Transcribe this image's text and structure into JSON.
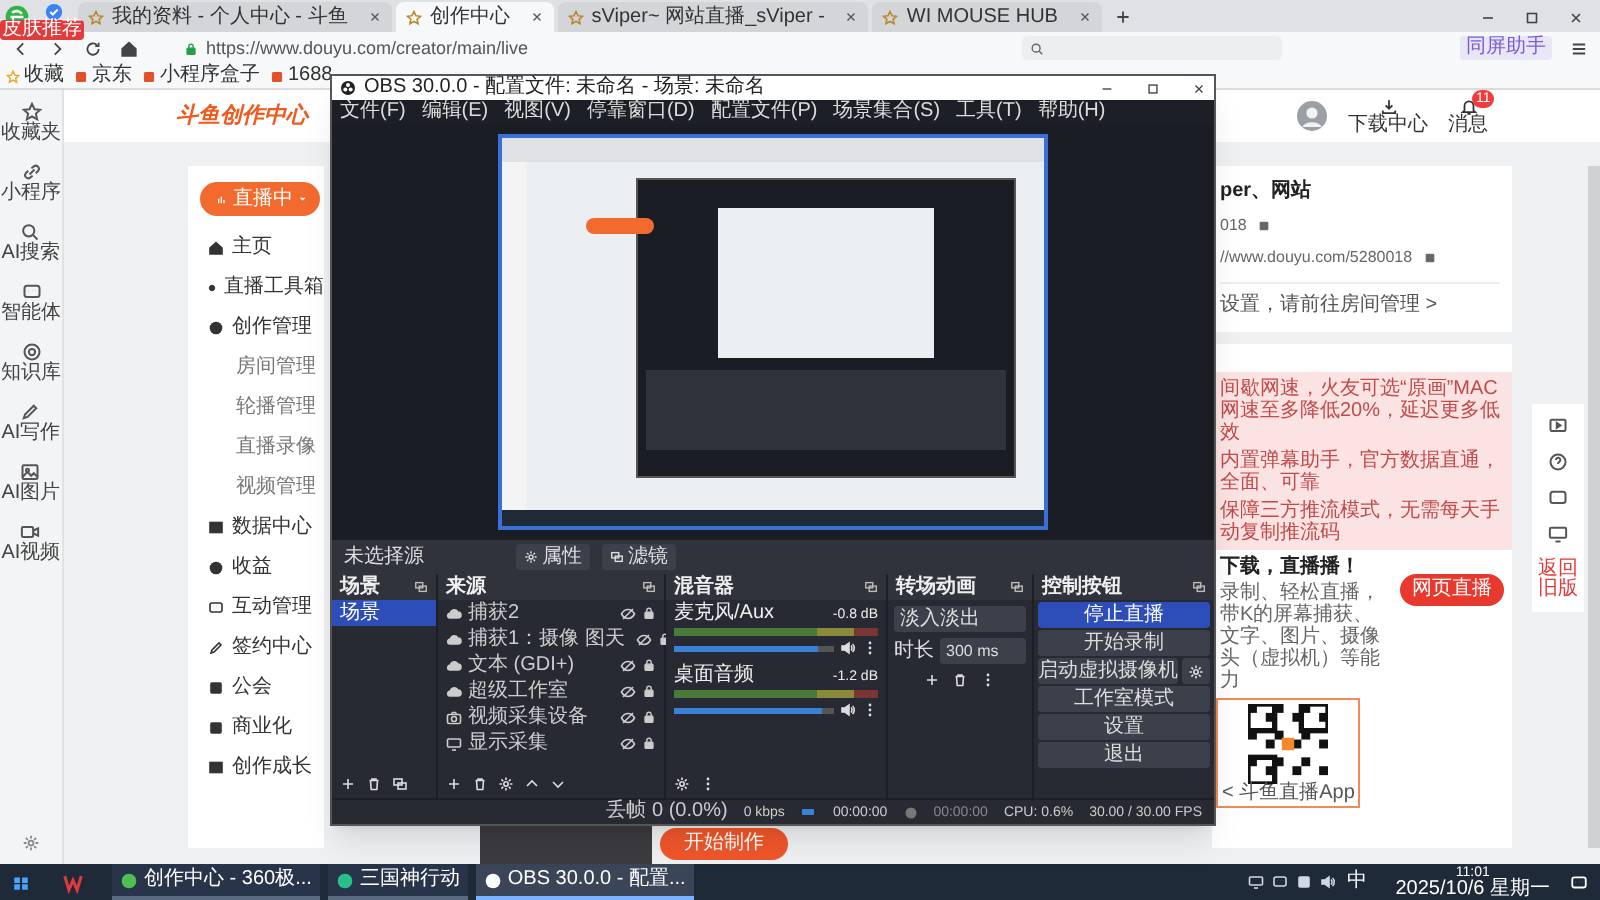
{
  "browser": {
    "tabs": [
      {
        "title": "我的资料 - 个人中心 - 斗鱼",
        "selected": false
      },
      {
        "title": "创作中心",
        "selected": true
      },
      {
        "title": "sViper~ 网站直播_sViper -",
        "selected": false
      },
      {
        "title": "WI MOUSE HUB",
        "selected": false
      }
    ],
    "skin_label": "皮肤推荐",
    "address": "https://www.douyu.com/creator/main/live",
    "bookmarks": [
      "收藏",
      "京东",
      "小程序盒子",
      "1688"
    ],
    "sync_button": "同屏助手"
  },
  "rail": [
    "收藏夹",
    "小程序",
    "AI搜索",
    "智能体",
    "知识库",
    "AI写作",
    "AI图片",
    "AI视频"
  ],
  "header": {
    "logo": "斗鱼创作中心",
    "download": "下载中心",
    "messages": "消息",
    "badge": "11"
  },
  "nav": {
    "live_button": "直播中",
    "items": [
      {
        "label": "主页",
        "kind": "main"
      },
      {
        "label": "直播工具箱",
        "kind": "main"
      },
      {
        "label": "创作管理",
        "kind": "main"
      },
      {
        "label": "房间管理",
        "kind": "sub"
      },
      {
        "label": "轮播管理",
        "kind": "sub"
      },
      {
        "label": "直播录像",
        "kind": "sub"
      },
      {
        "label": "视频管理",
        "kind": "sub"
      },
      {
        "label": "数据中心",
        "kind": "main"
      },
      {
        "label": "收益",
        "kind": "main"
      },
      {
        "label": "互动管理",
        "kind": "main"
      },
      {
        "label": "签约中心",
        "kind": "main"
      },
      {
        "label": "公会",
        "kind": "main"
      },
      {
        "label": "商业化",
        "kind": "main"
      },
      {
        "label": "创作成长",
        "kind": "main"
      }
    ]
  },
  "profile": {
    "name": "per、网站",
    "room": "018",
    "link": "//www.douyu.com/5280018",
    "hint": "设置，请前往房间管理 >"
  },
  "features": [
    "间歇网速，火友可选“原画”MAC网速至多降低20%，延迟更多低效",
    "内置弹幕助手，官方数据直通，全面、可靠",
    "保障三方推流模式，无需每天手动复制推流码"
  ],
  "promo": {
    "title": "下载，直播播！",
    "text": "录制、轻松直播，带K的屏幕捕获、文字、图片、摄像头（虚拟机）等能力",
    "button": "网页直播",
    "qr_caption": "< 斗鱼直播App"
  },
  "start_button": "开始制作",
  "float_bar": {
    "old_version": "返回旧版"
  },
  "obs": {
    "title": "OBS 30.0.0 - 配置文件: 未命名 - 场景: 未命名",
    "menu": [
      "文件(F)",
      "编辑(E)",
      "视图(V)",
      "停靠窗口(D)",
      "配置文件(P)",
      "场景集合(S)",
      "工具(T)",
      "帮助(H)"
    ],
    "no_source": "未选择源",
    "properties": "属性",
    "filters": "滤镜",
    "scenes": {
      "title": "场景",
      "items": [
        {
          "label": "场景",
          "selected": true
        }
      ]
    },
    "sources": {
      "title": "来源",
      "items": [
        {
          "label": "捕获2",
          "kind": "capture"
        },
        {
          "label": "捕获1：摄像 图天",
          "kind": "capture"
        },
        {
          "label": "文本 (GDI+)",
          "kind": "capture"
        },
        {
          "label": "超级工作室",
          "kind": "capture"
        },
        {
          "label": "视频采集设备",
          "kind": "camera"
        },
        {
          "label": "显示采集",
          "kind": "display"
        }
      ]
    },
    "mixer": {
      "title": "混音器",
      "channels": [
        {
          "name": "麦克风/Aux",
          "reading": "-0.8 dB",
          "level": 0.9
        },
        {
          "name": "桌面音频",
          "reading": "-1.2 dB",
          "level": 0.92
        }
      ]
    },
    "transitions": {
      "title": "转场动画",
      "type": "淡入淡出",
      "duration_label": "时长",
      "duration": "300 ms"
    },
    "controls": {
      "title": "控制按钮",
      "buttons": [
        {
          "label": "停止直播",
          "active": true
        },
        {
          "label": "开始录制",
          "active": false
        },
        {
          "label": "启动虚拟摄像机",
          "active": false
        },
        {
          "label": "工作室模式",
          "active": false
        },
        {
          "label": "设置",
          "active": false
        },
        {
          "label": "退出",
          "active": false
        }
      ]
    },
    "status": {
      "dropped": "丢帧 0 (0.0%)",
      "bitrate": "0 kbps",
      "live_time": "00:00:00",
      "rec_time": "00:00:00",
      "cpu": "CPU: 0.6%",
      "fps": "30.00 / 30.00 FPS"
    }
  },
  "taskbar": {
    "apps": [
      {
        "label": "创作中心 - 360极...",
        "selected": false
      },
      {
        "label": "三国神行动",
        "selected": false
      },
      {
        "label": "OBS 30.0.0 - 配置...",
        "selected": true
      }
    ],
    "ime": "中",
    "time": "11:01",
    "date": "2025/10/6 星期一"
  }
}
